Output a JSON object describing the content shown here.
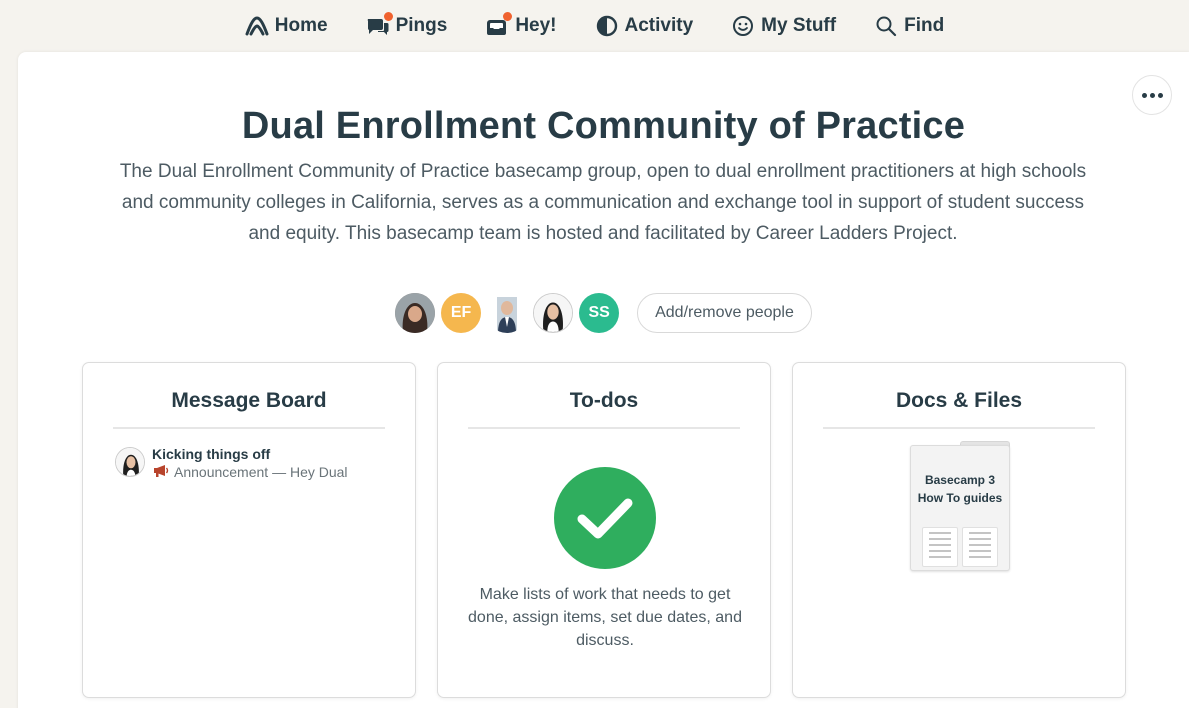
{
  "nav": {
    "items": [
      {
        "label": "Home",
        "icon": "basecamp-logo-icon"
      },
      {
        "label": "Pings",
        "icon": "pings-icon",
        "notification": true
      },
      {
        "label": "Hey!",
        "icon": "hey-icon",
        "notification": true
      },
      {
        "label": "Activity",
        "icon": "activity-icon"
      },
      {
        "label": "My Stuff",
        "icon": "smiley-icon"
      },
      {
        "label": "Find",
        "icon": "search-icon"
      }
    ],
    "notification_color": "#f0622f"
  },
  "project": {
    "title": "Dual Enrollment Community of Practice",
    "description": "The Dual Enrollment Community of Practice basecamp group, open to dual enrollment practitioners at high schools and community colleges in California, serves as a communication and exchange tool in support of student success and equity. This basecamp team is hosted and facilitated by Career Ladders Project.",
    "more_options_icon": "ellipsis-icon"
  },
  "people": {
    "avatars": [
      {
        "type": "photo"
      },
      {
        "type": "initials",
        "initials": "EF",
        "color": "#f5b74e"
      },
      {
        "type": "photo"
      },
      {
        "type": "photo"
      },
      {
        "type": "initials",
        "initials": "SS",
        "color": "#2bbb8f"
      }
    ],
    "add_remove_label": "Add/remove people"
  },
  "tools": {
    "message_board": {
      "title": "Message Board",
      "messages": [
        {
          "title": "Kicking things off",
          "category_icon": "megaphone-icon",
          "meta": "Announcement — Hey Dual"
        }
      ]
    },
    "todos": {
      "title": "To-dos",
      "icon": "checkmark-icon",
      "color": "#2fae5e",
      "description": "Make lists of work that needs to get done, assign items, set due dates, and discuss."
    },
    "docs": {
      "title": "Docs & Files",
      "folder_label": "Basecamp 3 How To guides"
    }
  }
}
